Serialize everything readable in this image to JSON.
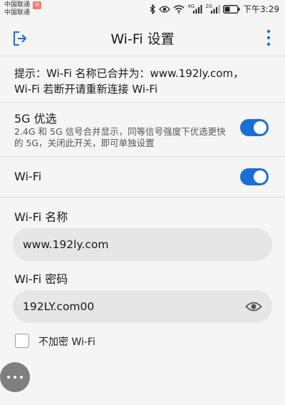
{
  "status_bar": {
    "carrier1": "中国联通",
    "carrier2": "中国联通",
    "signal1_label": "4G",
    "signal2_label": "2G",
    "time": "下午3:29",
    "icons": [
      "bluetooth-icon",
      "eye-comfort-icon",
      "wifi-icon",
      "signal-icon",
      "signal-icon",
      "battery-icon"
    ]
  },
  "header": {
    "title": "Wi-Fi 设置"
  },
  "notice": {
    "line1": "提示：Wi-Fi 名称已合并为：www.192ly.com，",
    "line2": "Wi-Fi 若断开请重新连接 Wi-Fi"
  },
  "band_steering": {
    "title": "5G 优选",
    "description": "2.4G 和 5G 信号合并显示，同等信号强度下优选更快的 5G，关闭此开关，即可单独设置",
    "enabled": true
  },
  "wifi_toggle": {
    "label": "Wi-Fi",
    "enabled": true
  },
  "ssid": {
    "label": "Wi-Fi 名称",
    "value": "www.192ly.com"
  },
  "password": {
    "label": "Wi-Fi 密码",
    "value": "192LY.com00"
  },
  "no_encryption": {
    "label": "不加密 Wi-Fi",
    "checked": false
  },
  "colors": {
    "accent": "#1a6ed8",
    "background": "#f5f5f5",
    "field": "#e6e6e6"
  }
}
